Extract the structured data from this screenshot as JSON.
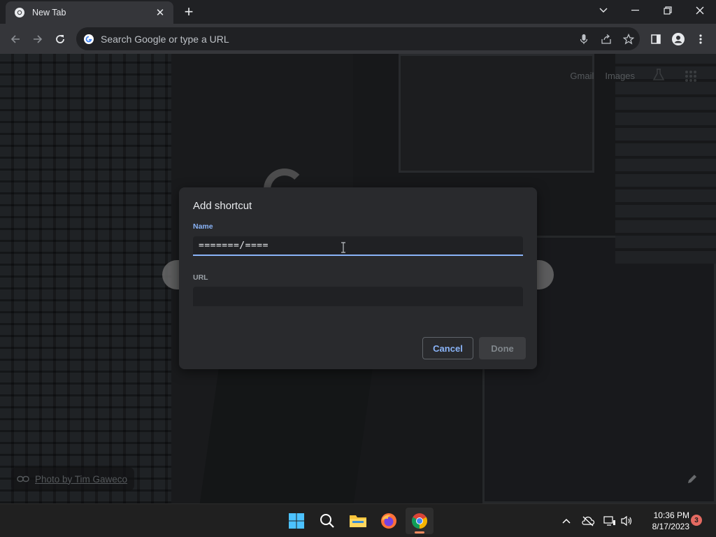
{
  "browser": {
    "tab": {
      "title": "New Tab",
      "icon": "chrome-icon"
    },
    "omnibox": {
      "placeholder": "Search Google or type a URL"
    }
  },
  "ntp": {
    "links": [
      "Gmail",
      "Images"
    ],
    "attribution": "Photo by Tim Gaweco"
  },
  "dialog": {
    "title": "Add shortcut",
    "name_label": "Name",
    "name_value": "=======/====",
    "url_label": "URL",
    "url_value": "",
    "cancel_label": "Cancel",
    "done_label": "Done"
  },
  "taskbar": {
    "apps": [
      "windows-start-icon",
      "search-icon",
      "file-explorer-icon",
      "firefox-icon",
      "chrome-icon"
    ],
    "time": "10:36 PM",
    "date": "8/17/2023",
    "notification_count": "3"
  },
  "colors": {
    "accent": "#8ab4f8",
    "dialog_bg": "#292a2d",
    "chrome_toolbar": "#35363a"
  }
}
